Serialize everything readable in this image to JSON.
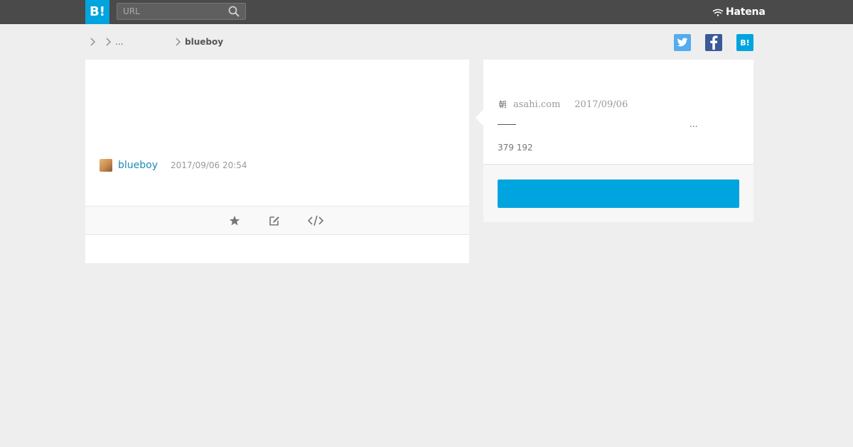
{
  "header": {
    "logo_text": "B!",
    "search_placeholder": "URL",
    "brand": "Hatena",
    "bar_color": "#4a4a4a",
    "accent_color": "#00a4de"
  },
  "breadcrumb": {
    "items": [
      {
        "label": ""
      },
      {
        "label": "..."
      },
      {
        "label": "blueboy"
      }
    ]
  },
  "share": {
    "twitter_icon": "twitter-icon",
    "facebook_icon": "facebook-icon",
    "hatena_label": "B!"
  },
  "comment": {
    "user": "blueboy",
    "timestamp": "2017/09/06 20:54",
    "actions": [
      "star-icon",
      "edit-icon",
      "embed-code-icon"
    ]
  },
  "entry": {
    "favicon_glyph": "朝",
    "source": "asahi.com",
    "date": "2017/09/06",
    "snippet_ellipsis": "...",
    "counts": "379 192",
    "cta_color": "#00a4de"
  }
}
